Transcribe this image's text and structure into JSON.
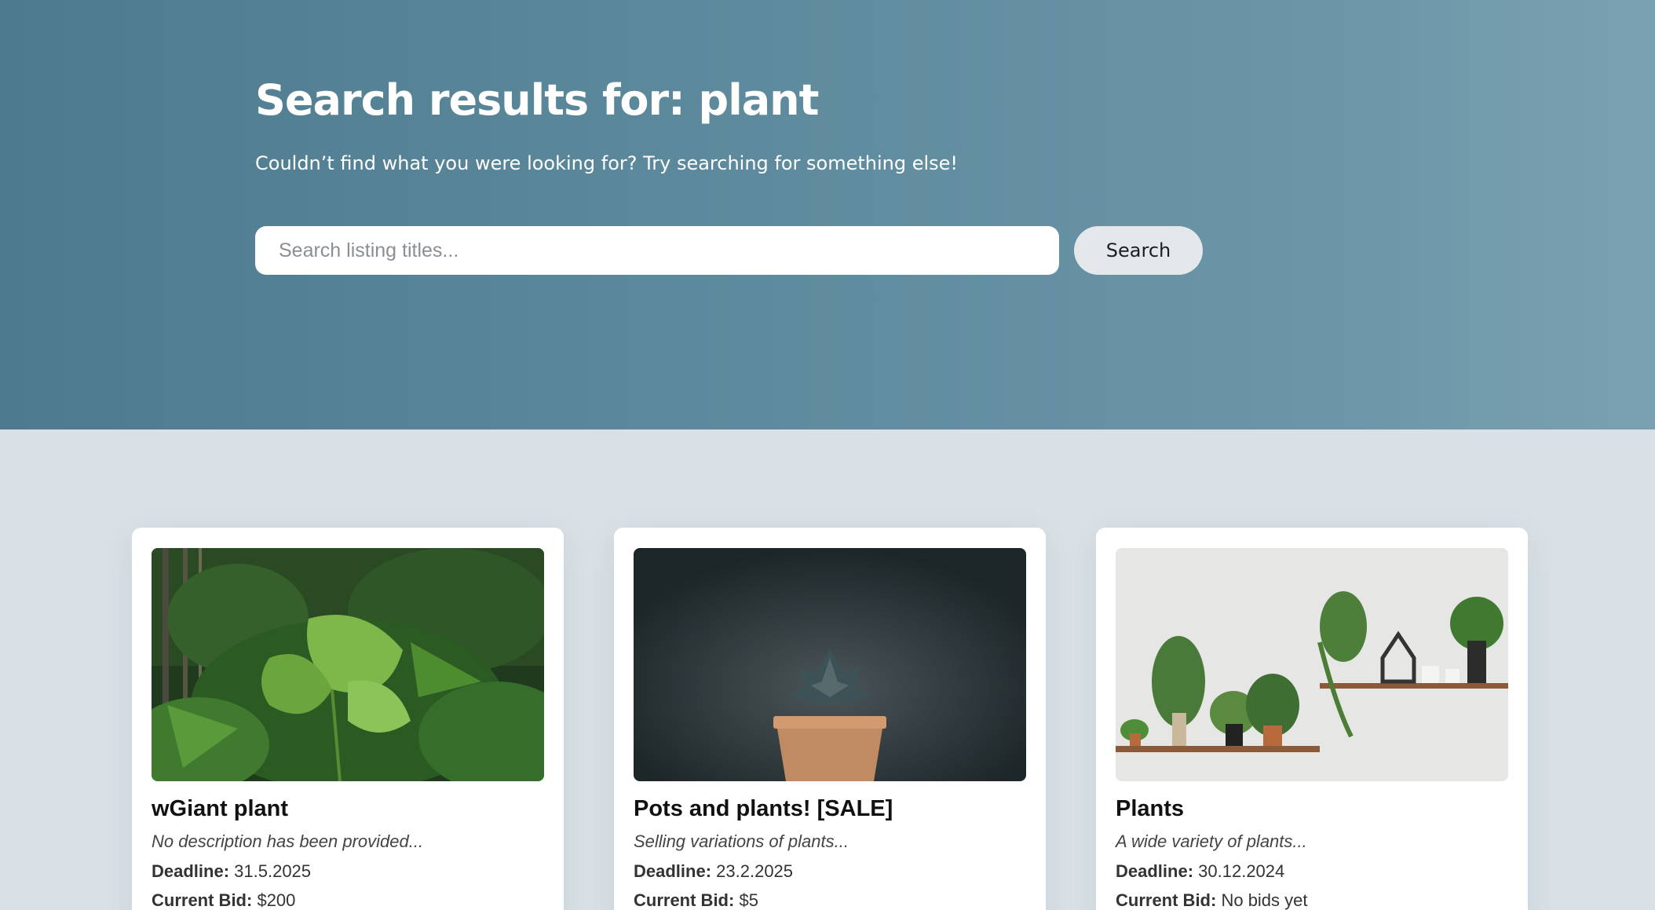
{
  "hero": {
    "title": "Search results for: plant",
    "subtitle": "Couldn’t find what you were looking for? Try searching for something else!"
  },
  "search": {
    "placeholder": "Search listing titles...",
    "value": "",
    "button_label": "Search"
  },
  "meta_labels": {
    "deadline": "Deadline:",
    "current_bid": "Current Bid:"
  },
  "listings": [
    {
      "title": "wGiant plant",
      "description": "No description has been provided...",
      "deadline": "31.5.2025",
      "current_bid": "$200",
      "image": "jungle-foliage-photo"
    },
    {
      "title": "Pots and plants! [SALE]",
      "description": "Selling variations of plants...",
      "deadline": "23.2.2025",
      "current_bid": "$5",
      "image": "potted-succulent-photo"
    },
    {
      "title": "Plants",
      "description": "A wide variety of plants...",
      "deadline": "30.12.2024",
      "current_bid": "No bids yet",
      "image": "shelf-houseplants-photo"
    }
  ],
  "colors": {
    "hero_start": "#4e7a8f",
    "hero_end": "#7aa1b1",
    "page_background": "#d9e1e6",
    "button_background": "#e4e8ea"
  }
}
